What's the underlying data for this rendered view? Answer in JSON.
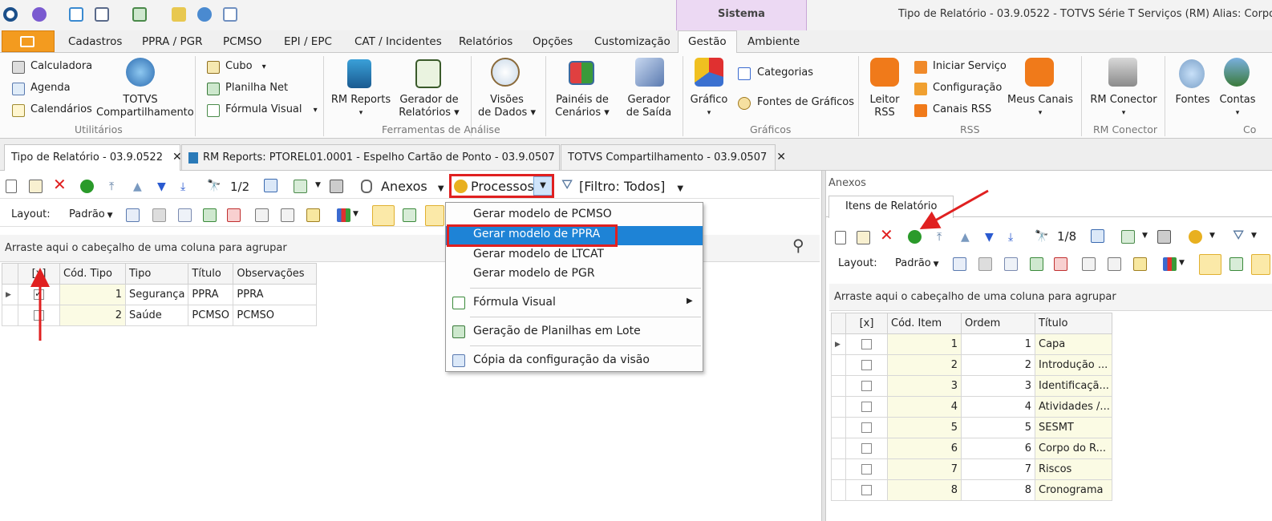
{
  "window": {
    "title": "Tipo de Relatório - 03.9.0522 - TOTVS Série T Serviços (RM) Alias: CorporeR",
    "context_tab": "Sistema"
  },
  "ribbon_tabs": [
    "Cadastros",
    "PPRA / PGR",
    "PCMSO",
    "EPI / EPC",
    "CAT / Incidentes",
    "Relatórios",
    "Opções",
    "Customização",
    "Gestão",
    "Ambiente"
  ],
  "ribbon": {
    "utilitarios": {
      "items": [
        "Calculadora",
        "Agenda",
        "Calendários"
      ],
      "big": [
        "TOTVS",
        "Compartilhamento"
      ],
      "label": "Utilitários"
    },
    "ferramentas": {
      "small": [
        "Cubo",
        "Planilha Net",
        "Fórmula Visual"
      ],
      "big1": "RM Reports",
      "big2a": "Gerador de",
      "big2b": "Relatórios",
      "big3a": "Visões",
      "big3b": "de Dados",
      "big4a": "Painéis de",
      "big4b": "Cenários",
      "big5a": "Gerador",
      "big5b": "de Saída",
      "label": "Ferramentas de Análise"
    },
    "graficos": {
      "big": "Gráfico",
      "small": [
        "Categorias",
        "Fontes de Gráficos"
      ],
      "label": "Gráficos"
    },
    "rss": {
      "big1a": "Leitor",
      "big1b": "RSS",
      "small": [
        "Iniciar Serviço",
        "Configuração",
        "Canais RSS"
      ],
      "big2": "Meus Canais",
      "label": "RSS"
    },
    "rmconector": {
      "big": "RM Conector",
      "label": "RM Conector"
    },
    "outros": {
      "a": "Fontes",
      "b": "Contas",
      "label": "Co"
    }
  },
  "doc_tabs": [
    "Tipo de Relatório - 03.9.0522",
    "RM Reports: PTOREL01.0001 - Espelho Cartão de Ponto - 03.9.0507",
    "TOTVS Compartilhamento - 03.9.0507"
  ],
  "toolbar": {
    "page": "1/2",
    "anexos": "Anexos",
    "processos": "Processos",
    "filtro": "[Filtro: Todos]",
    "layout": "Layout:",
    "padrao": "Padrão"
  },
  "left_grid": {
    "group_hint": "Arraste aqui o cabeçalho de uma coluna para agrupar",
    "columns": [
      "[x]",
      "Cód. Tipo",
      "Tipo",
      "Título",
      "Observações"
    ],
    "rows": [
      {
        "checked": true,
        "cod": "1",
        "tipo": "Segurança",
        "titulo": "PPRA",
        "obs": "PPRA"
      },
      {
        "checked": false,
        "cod": "2",
        "tipo": "Saúde",
        "titulo": "PCMSO",
        "obs": "PCMSO"
      }
    ]
  },
  "menu": {
    "items": [
      "Gerar modelo de PCMSO",
      "Gerar modelo de PPRA",
      "Gerar modelo de LTCAT",
      "Gerar modelo de PGR",
      "Fórmula Visual",
      "Geração de Planilhas em Lote",
      "Cópia da configuração da visão"
    ],
    "selected": "Gerar modelo de PPRA",
    "submenu_arrow": "▶"
  },
  "right_panel": {
    "title": "Anexos",
    "tab": "Itens de Relatório",
    "page": "1/8",
    "layout": "Layout:",
    "padrao": "Padrão",
    "group_hint": "Arraste aqui o cabeçalho de uma coluna para agrupar",
    "columns": [
      "[x]",
      "Cód. Item",
      "Ordem",
      "Título"
    ],
    "rows": [
      {
        "cod": "1",
        "ordem": "1",
        "titulo": "Capa"
      },
      {
        "cod": "2",
        "ordem": "2",
        "titulo": "Introdução ..."
      },
      {
        "cod": "3",
        "ordem": "3",
        "titulo": "Identificaçã..."
      },
      {
        "cod": "4",
        "ordem": "4",
        "titulo": "Atividades /..."
      },
      {
        "cod": "5",
        "ordem": "5",
        "titulo": "SESMT"
      },
      {
        "cod": "6",
        "ordem": "6",
        "titulo": "Corpo do R..."
      },
      {
        "cod": "7",
        "ordem": "7",
        "titulo": "Riscos"
      },
      {
        "cod": "8",
        "ordem": "8",
        "titulo": "Cronograma"
      }
    ]
  },
  "colors": {
    "accent": "#1e83d6",
    "file_tab": "#f39b1f",
    "highlight": "#e02020",
    "context": "#ecd9f3"
  }
}
